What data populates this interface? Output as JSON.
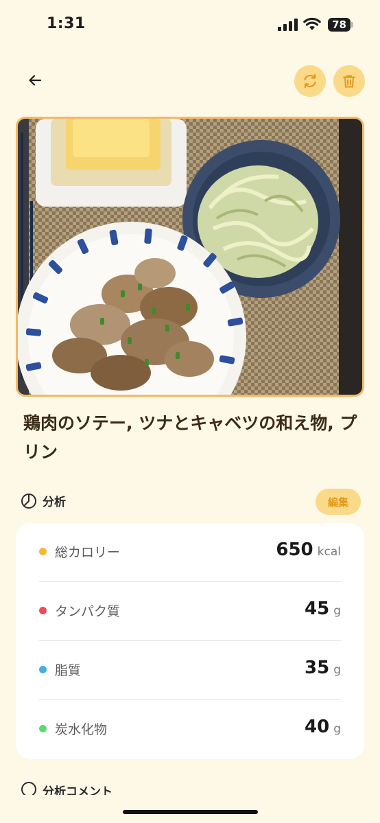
{
  "status_bar": {
    "time": "1:31",
    "battery": "78"
  },
  "header": {
    "back_icon": "arrow-left-icon",
    "refresh_icon": "refresh-icon",
    "delete_icon": "trash-icon"
  },
  "meal": {
    "title": "鶏肉のソテー, ツナとキャベツの和え物, プリン"
  },
  "analysis": {
    "label": "分析",
    "edit_label": "編集",
    "items": [
      {
        "label": "総カロリー",
        "value": "650",
        "unit": "kcal",
        "color": "#F8B733"
      },
      {
        "label": "タンパク質",
        "value": "45",
        "unit": "g",
        "color": "#EE4B5A"
      },
      {
        "label": "脂質",
        "value": "35",
        "unit": "g",
        "color": "#3FB0EB"
      },
      {
        "label": "炭水化物",
        "value": "40",
        "unit": "g",
        "color": "#5ADB6B"
      }
    ]
  },
  "comment": {
    "label": "分析コメント"
  },
  "colors": {
    "background": "#FEF8E7",
    "accent": "#FAD988",
    "accent_text": "#E09A1E",
    "title": "#3B2A16"
  }
}
